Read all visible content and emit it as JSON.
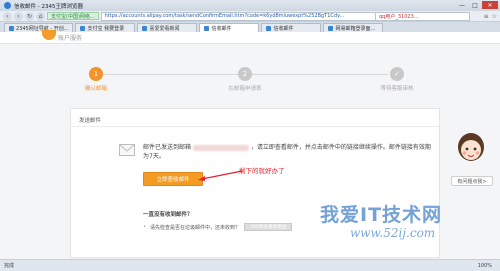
{
  "browser": {
    "title": "信收邮件 - 2345王牌浏览器",
    "secure_label": "支付宝(中国)网络...",
    "url": "https://accounts.alipay.com/task/sendConfirmEmail.htm?code=k6yd8mluwexpt%252BgT1Cdy...",
    "search_text": "qq用户_31023...",
    "tabs": [
      {
        "label": "2345网址导航 - 开创..."
      },
      {
        "label": "支付宝 我要登录"
      },
      {
        "label": "喜爱爱看新闻"
      },
      {
        "label": "信收邮件"
      },
      {
        "label": "信收邮件"
      },
      {
        "label": "网易邮箱登录面..."
      }
    ],
    "window_controls": [
      "—",
      "□",
      "✕"
    ],
    "brand_text": "账户服务"
  },
  "steps": [
    {
      "number": "1",
      "label": "确认邮箱",
      "state": "done"
    },
    {
      "number": "2",
      "label": "在邮箱申请表",
      "state": "todo"
    },
    {
      "number": "✓",
      "label": "等待客服审核",
      "state": "todo"
    }
  ],
  "card": {
    "title": "发送邮件",
    "message_pre": "邮件已发送到邮箱",
    "message_post": "，请立即查看邮件，并点击邮件中的链接继续操作。邮件链接有效期为7天。",
    "open_button": "立即查收邮件",
    "annotation": "剩下的就好办了",
    "help_title": "一直没有收到邮件？",
    "help_text": "请先检查是否在垃圾邮件中，还未收到？",
    "resend_button": "(60)秒后重新发送"
  },
  "assistant": {
    "button_label": "有问题点我>"
  },
  "status": {
    "left": "完成",
    "zoom": "100%"
  },
  "watermark": {
    "text": "我爱IT技术网",
    "url": "www.52ij.com"
  },
  "colors": {
    "accent": "#f49b24",
    "annotation": "#e4222c",
    "step_active": "#f3932c",
    "step_inactive": "#c8c8c8"
  }
}
